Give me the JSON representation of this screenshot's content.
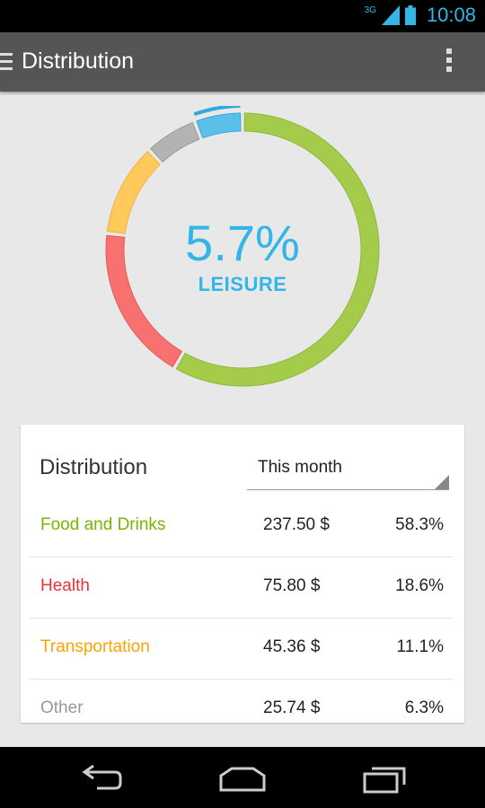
{
  "status_bar": {
    "network": "3G",
    "time": "10:08"
  },
  "action_bar": {
    "title": "Distribution"
  },
  "donut": {
    "center_percent": "5.7%",
    "center_label": "LEISURE",
    "selected": "Leisure",
    "segments": [
      {
        "name": "Food and Drinks",
        "percent": 58.3,
        "color": "#a4cc4a",
        "stroke": "#8fb83a"
      },
      {
        "name": "Health",
        "percent": 18.6,
        "color": "#f6716f",
        "stroke": "#e55a58"
      },
      {
        "name": "Transportation",
        "percent": 11.1,
        "color": "#ffc95c",
        "stroke": "#f0b33f"
      },
      {
        "name": "Other",
        "percent": 6.3,
        "color": "#b3b3b3",
        "stroke": "#9d9d9d"
      },
      {
        "name": "Leisure",
        "percent": 5.7,
        "color": "#5bbfe8",
        "stroke": "#33a8db"
      }
    ]
  },
  "card": {
    "title": "Distribution",
    "period": "This month",
    "rows": [
      {
        "name": "Food and Drinks",
        "amount": "237.50 $",
        "percent": "58.3%",
        "color": "#7cb200"
      },
      {
        "name": "Health",
        "amount": "75.80 $",
        "percent": "18.6%",
        "color": "#e8323b"
      },
      {
        "name": "Transportation",
        "amount": "45.36 $",
        "percent": "11.1%",
        "color": "#ffa200"
      },
      {
        "name": "Other",
        "amount": "25.74 $",
        "percent": "6.3%",
        "color": "#999999"
      }
    ]
  },
  "nav": {
    "icons": [
      "back-icon",
      "home-icon",
      "recent-apps-icon"
    ]
  }
}
